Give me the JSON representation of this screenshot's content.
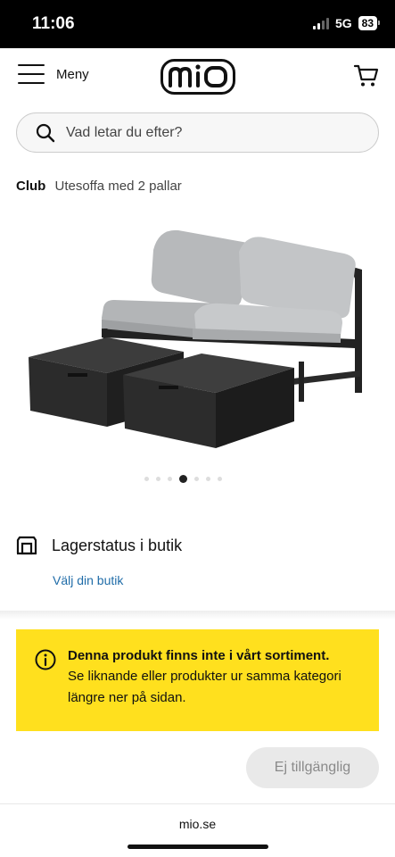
{
  "status_bar": {
    "time": "11:06",
    "network": "5G",
    "battery": "83"
  },
  "header": {
    "menu_label": "Meny",
    "logo_text": "mio",
    "cart_icon": "cart-icon"
  },
  "search": {
    "placeholder": "Vad letar du efter?",
    "icon": "search-icon"
  },
  "product": {
    "brand": "Club",
    "name": "Utesoffa med 2 pallar",
    "image_alt": "Utesoffa med 2 pallar",
    "carousel": {
      "total": 7,
      "active_index": 3
    }
  },
  "stock": {
    "title": "Lagerstatus i butik",
    "link": "Välj din butik",
    "icon": "store-icon"
  },
  "notice": {
    "headline": "Denna produkt finns inte i vårt sortiment.",
    "body": "Se liknande eller produkter ur samma kategori längre ner på sidan.",
    "icon": "info-icon",
    "color": "#ffe01e"
  },
  "buy_button": {
    "label": "Ej tillgänglig"
  },
  "browser": {
    "domain": "mio.se"
  }
}
